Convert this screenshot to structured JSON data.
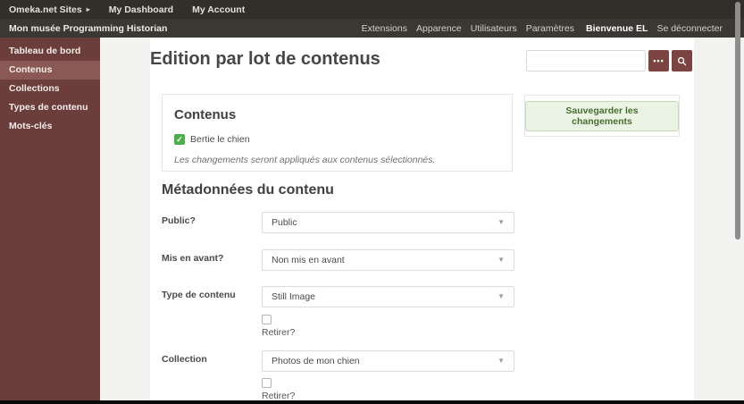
{
  "topbar": {
    "brand": "Omeka.net Sites",
    "items": [
      "My Dashboard",
      "My Account"
    ]
  },
  "adminbar": {
    "site_title": "Mon musée Programming Historian",
    "links": [
      "Extensions",
      "Apparence",
      "Utilisateurs",
      "Paramètres"
    ],
    "welcome": "Bienvenue EL",
    "logout": "Se déconnecter"
  },
  "sidebar": {
    "items": [
      {
        "label": "Tableau de bord",
        "active": false
      },
      {
        "label": "Contenus",
        "active": true
      },
      {
        "label": "Collections",
        "active": false
      },
      {
        "label": "Types de contenu",
        "active": false
      },
      {
        "label": "Mots-clés",
        "active": false
      }
    ]
  },
  "header": {
    "title": "Edition par lot de contenus",
    "search": {
      "value": "",
      "placeholder": ""
    }
  },
  "items_panel": {
    "heading": "Contenus",
    "checkbox_label": "Bertie le chien",
    "checkbox_checked": true,
    "note": "Les changements seront appliqués aux contenus sélectionnés."
  },
  "save_panel": {
    "button_label": "Sauvegarder les changements"
  },
  "metadata": {
    "heading": "Métadonnées du contenu",
    "fields": [
      {
        "label": "Public?",
        "value": "Public"
      },
      {
        "label": "Mis en avant?",
        "value": "Non mis en avant"
      },
      {
        "label": "Type de contenu",
        "value": "Still Image",
        "remove_label": "Retirer?",
        "remove_checked": false
      },
      {
        "label": "Collection",
        "value": "Photos de mon chien",
        "remove_label": "Retirer?",
        "remove_checked": false
      }
    ]
  },
  "icons": {
    "caret_right": "▸",
    "ellipsis": "•••",
    "check": "✓",
    "chevron_down": "▼"
  },
  "colors": {
    "topbar_bg": "#322e29",
    "adminbar_bg": "#3b3733",
    "sidebar_bg": "#6b3e3c",
    "sidebar_active_bg": "#8a5955",
    "accent_maroon": "#7c4441",
    "checkbox_green": "#4cae4c",
    "save_button_bg": "#ebf3e5",
    "save_button_text": "#47702f",
    "page_bg": "#f2f2f0"
  }
}
